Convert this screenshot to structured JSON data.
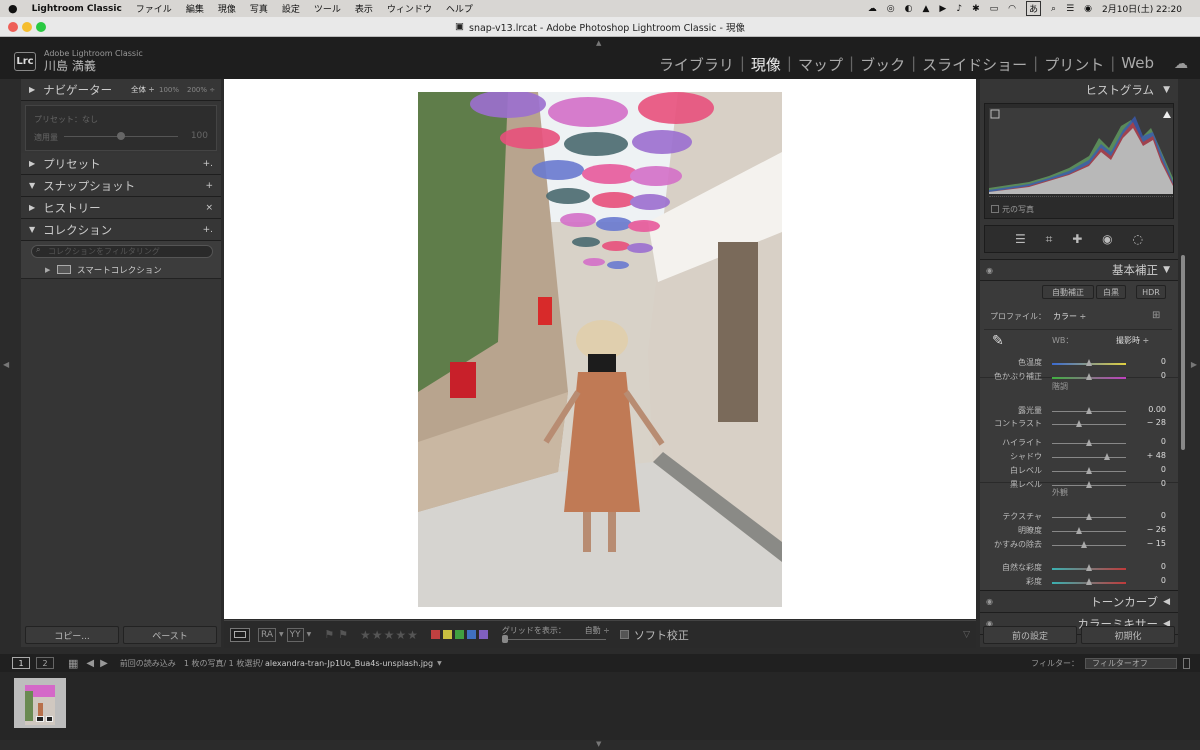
{
  "menubar": {
    "app": "Lightroom Classic",
    "items": [
      "ファイル",
      "編集",
      "現像",
      "写真",
      "設定",
      "ツール",
      "表示",
      "ウィンドウ",
      "ヘルプ"
    ],
    "date": "2月10日(土) 22:20",
    "input_indicator": "あ"
  },
  "window": {
    "title": "snap-v13.lrcat - Adobe Photoshop Lightroom Classic - 現像"
  },
  "identity": {
    "app_label": "Adobe Lightroom Classic",
    "user": "川島 満義",
    "logo": "Lrc"
  },
  "modules": [
    "ライブラリ",
    "現像",
    "マップ",
    "ブック",
    "スライドショー",
    "プリント",
    "Web"
  ],
  "active_module": "現像",
  "left_panel": {
    "navigator": {
      "label": "ナビゲーター",
      "zoom_options": [
        "全体 ÷",
        "100%",
        "200% ÷"
      ]
    },
    "preset_box": {
      "preset_text": "プリセット：なし",
      "amount_label": "適用量",
      "amount_value": "100"
    },
    "sections": [
      {
        "label": "プリセット",
        "action": "+."
      },
      {
        "label": "スナップショット",
        "action": "+"
      },
      {
        "label": "ヒストリー",
        "action": "×"
      },
      {
        "label": "コレクション",
        "action": "+."
      }
    ],
    "collection_search_placeholder": "コレクションをフィルタリング",
    "smart_collection": "スマートコレクション",
    "copy_button": "コピー...",
    "paste_button": "ペースト"
  },
  "toolbar": {
    "view_modes": [
      "RA",
      "YY"
    ],
    "grid_label": "グリッドを表示：",
    "grid_value": "自動 ÷",
    "soft_proof": "ソフト校正",
    "color_labels": [
      "#c04040",
      "#c8c040",
      "#40a040",
      "#4070c0",
      "#8060c0"
    ]
  },
  "right_panel": {
    "histogram_label": "ヒストグラム",
    "original_photo": "元の写真",
    "basic_label": "基本補正",
    "buttons": {
      "auto": "自動補正",
      "bw": "白黒",
      "hdr": "HDR"
    },
    "profile_label": "プロファイル：",
    "profile_value": "カラー ÷",
    "wb_label": "WB：",
    "wb_value": "撮影時 ÷",
    "tone_section": "階調",
    "presence_section": "外観",
    "sliders": [
      {
        "label": "色温度",
        "value": "0",
        "pos": 0.5
      },
      {
        "label": "色かぶり補正",
        "value": "0",
        "pos": 0.5
      },
      {
        "label": "露光量",
        "value": "0.00",
        "pos": 0.5
      },
      {
        "label": "コントラスト",
        "value": "− 28",
        "pos": 0.36
      },
      {
        "label": "ハイライト",
        "value": "0",
        "pos": 0.5
      },
      {
        "label": "シャドウ",
        "value": "+ 48",
        "pos": 0.74
      },
      {
        "label": "白レベル",
        "value": "0",
        "pos": 0.5
      },
      {
        "label": "黒レベル",
        "value": "0",
        "pos": 0.5
      },
      {
        "label": "テクスチャ",
        "value": "0",
        "pos": 0.5
      },
      {
        "label": "明瞭度",
        "value": "− 26",
        "pos": 0.37
      },
      {
        "label": "かすみの除去",
        "value": "− 15",
        "pos": 0.43
      },
      {
        "label": "自然な彩度",
        "value": "0",
        "pos": 0.5
      },
      {
        "label": "彩度",
        "value": "0",
        "pos": 0.5
      }
    ],
    "tone_curve": "トーンカーブ",
    "color_mixer": "カラーミキサー",
    "previous_button": "前の設定",
    "reset_button": "初期化"
  },
  "filmbar": {
    "page1": "1",
    "page2": "2",
    "source": "前回の読み込み",
    "count": "1 枚の写真/ 1 枚選択/",
    "filename": "alexandra-tran-Jp1Uo_Bua4s-unsplash.jpg",
    "filter_label": "フィルター：",
    "filter_value": "フィルターオフ"
  }
}
